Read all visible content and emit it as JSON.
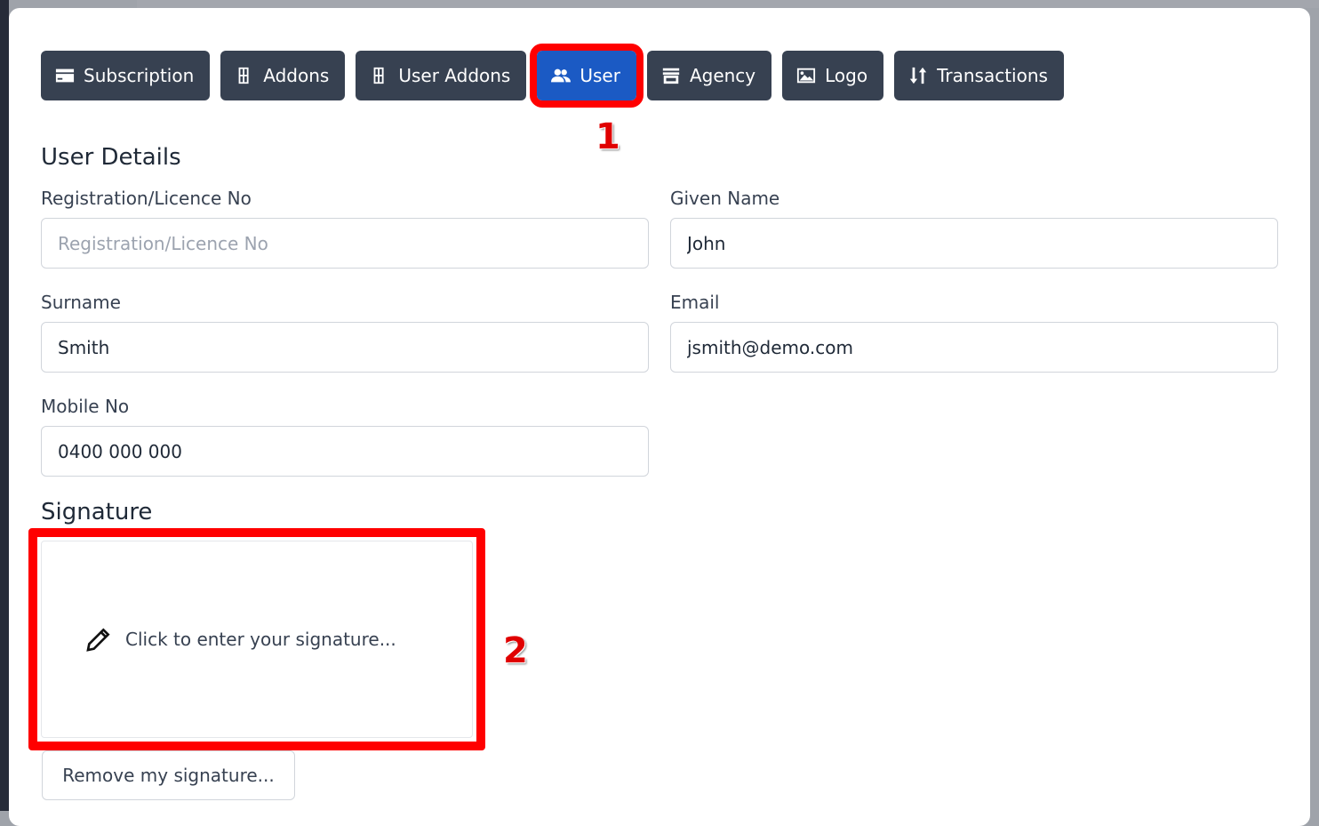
{
  "tabs": [
    {
      "label": "Subscription",
      "icon": "credit-card-icon"
    },
    {
      "label": "Addons",
      "icon": "cubes-icon"
    },
    {
      "label": "User Addons",
      "icon": "cubes-icon"
    },
    {
      "label": "User",
      "icon": "users-icon",
      "active": true
    },
    {
      "label": "Agency",
      "icon": "store-icon"
    },
    {
      "label": "Logo",
      "icon": "image-icon"
    },
    {
      "label": "Transactions",
      "icon": "sort-arrows-icon"
    }
  ],
  "user_details": {
    "title": "User Details",
    "registration": {
      "label": "Registration/Licence No",
      "value": "",
      "placeholder": "Registration/Licence No"
    },
    "given_name": {
      "label": "Given Name",
      "value": "John"
    },
    "surname": {
      "label": "Surname",
      "value": "Smith"
    },
    "email": {
      "label": "Email",
      "value": "jsmith@demo.com"
    },
    "mobile": {
      "label": "Mobile No",
      "value": "0400 000 000"
    }
  },
  "signature": {
    "title": "Signature",
    "prompt": "Click to enter your signature...",
    "remove_label": "Remove my signature..."
  },
  "annotations": {
    "a1": "1",
    "a2": "2"
  },
  "colors": {
    "tab_bg": "#374151",
    "tab_active": "#1b5ac4",
    "highlight": "#ff0000"
  }
}
